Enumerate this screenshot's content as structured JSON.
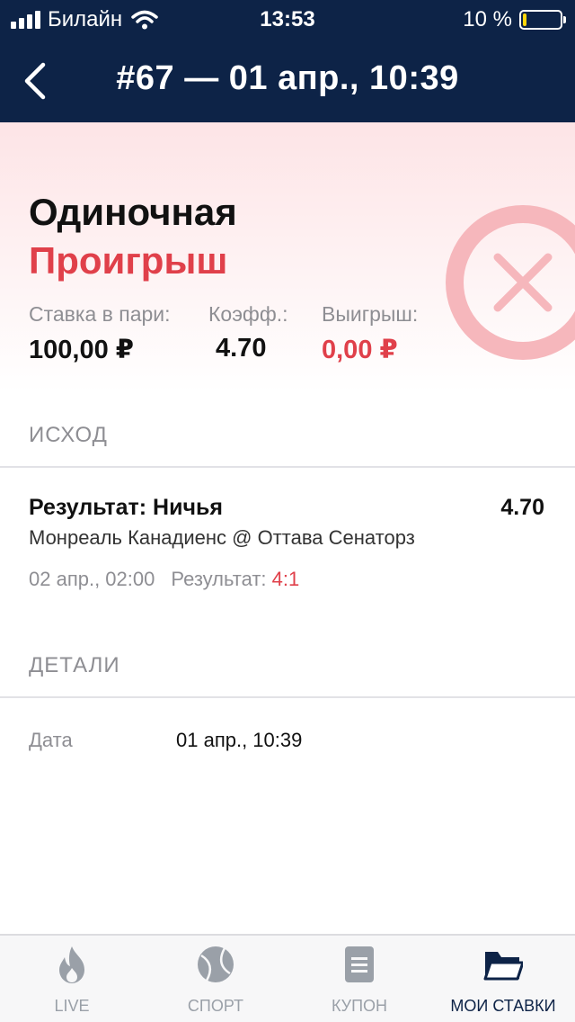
{
  "status_bar": {
    "carrier": "Билайн",
    "time": "13:53",
    "battery": "10 %",
    "battery_level": 0.1
  },
  "nav": {
    "title": "#67 — 01 апр., 10:39"
  },
  "summary": {
    "bet_type": "Одиночная",
    "status": "Проигрыш",
    "stake_label": "Ставка в пари:",
    "stake_value": "100,00 ₽",
    "odds_label": "Коэфф.:",
    "odds_value": "4.70",
    "win_label": "Выигрыш:",
    "win_value": "0,00 ₽"
  },
  "outcome_section": {
    "title": "ИСХОД",
    "name": "Результат: Ничья",
    "odds": "4.70",
    "match": "Монреаль Канадиенс @ Оттава Сенаторз",
    "datetime": "02 апр., 02:00",
    "result_label": "Результат:",
    "result_score": "4:1"
  },
  "details_section": {
    "title": "ДЕТАЛИ",
    "date_label": "Дата",
    "date_value": "01 апр., 10:39"
  },
  "tabbar": {
    "items": [
      {
        "label": "LIVE",
        "icon": "flame-icon",
        "active": false
      },
      {
        "label": "СПОРТ",
        "icon": "ball-icon",
        "active": false
      },
      {
        "label": "КУПОН",
        "icon": "coupon-icon",
        "active": false
      },
      {
        "label": "МОИ СТАВКИ",
        "icon": "folder-icon",
        "active": true
      }
    ]
  },
  "colors": {
    "header_bg": "#0d2347",
    "loss_red": "#e0404a",
    "muted_text": "#8e8e93",
    "tab_inactive": "#9aa0a8",
    "battery_low": "#ffd60a"
  }
}
